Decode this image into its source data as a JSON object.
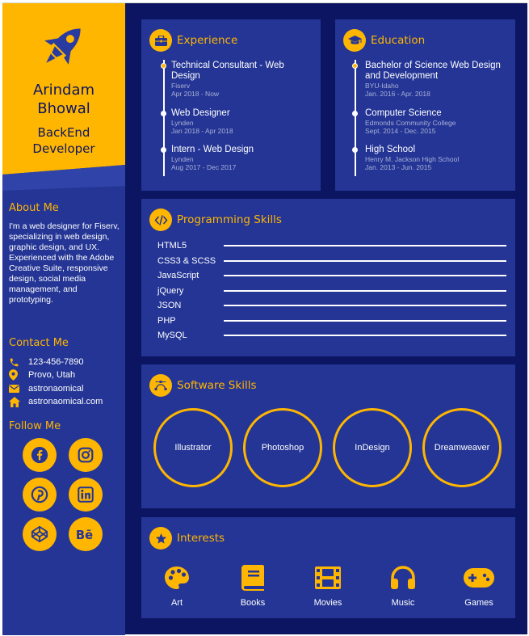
{
  "profile": {
    "first_name": "Arindam",
    "last_name": "Bhowal",
    "role_line1": "BackEnd",
    "role_line2": "Developer"
  },
  "about": {
    "heading": "About Me",
    "text": "I'm a web designer for Fiserv, specializing in web design, graphic design, and UX. Experienced with the Adobe Creative Suite, responsive design, social media management, and prototyping."
  },
  "contact": {
    "heading": "Contact Me",
    "phone": "123-456-7890",
    "location": "Provo, Utah",
    "email": "astronaomical",
    "website": "astronaomical.com"
  },
  "follow": {
    "heading": "Follow Me",
    "icons": [
      "facebook-icon",
      "instagram-icon",
      "pinterest-icon",
      "linkedin-icon",
      "codepen-icon",
      "behance-icon"
    ]
  },
  "experience": {
    "title": "Experience",
    "items": [
      {
        "title": "Technical Consultant - Web Design",
        "company": "Fiserv",
        "dates": "Apr 2018 - Now"
      },
      {
        "title": "Web Designer",
        "company": "Lynden",
        "dates": "Jan 2018 - Apr 2018"
      },
      {
        "title": "Intern - Web Design",
        "company": "Lynden",
        "dates": "Aug 2017 - Dec 2017"
      }
    ]
  },
  "education": {
    "title": "Education",
    "items": [
      {
        "title": "Bachelor of Science Web Design and Development",
        "school": "BYU-Idaho",
        "dates": "Jan. 2016 - Apr. 2018"
      },
      {
        "title": "Computer Science",
        "school": "Edmonds Community College",
        "dates": "Sept. 2014 - Dec. 2015"
      },
      {
        "title": "High School",
        "school": "Henry M. Jackson High School",
        "dates": "Jan. 2013 - Jun. 2015"
      }
    ]
  },
  "programming": {
    "title": "Programming Skills",
    "skills": [
      "HTML5",
      "CSS3 & SCSS",
      "JavaScript",
      "jQuery",
      "JSON",
      "PHP",
      "MySQL"
    ]
  },
  "software": {
    "title": "Software Skills",
    "skills": [
      "Illustrator",
      "Photoshop",
      "InDesign",
      "Dreamweaver"
    ]
  },
  "interests": {
    "title": "Interests",
    "items": [
      {
        "label": "Art",
        "icon": "palette-icon"
      },
      {
        "label": "Books",
        "icon": "book-icon"
      },
      {
        "label": "Movies",
        "icon": "film-icon"
      },
      {
        "label": "Music",
        "icon": "headphones-icon"
      },
      {
        "label": "Games",
        "icon": "gamepad-icon"
      }
    ]
  },
  "colors": {
    "accent": "#ffb600",
    "page_bg": "#0c1561",
    "card_bg": "#243595",
    "text": "#ffffff"
  }
}
